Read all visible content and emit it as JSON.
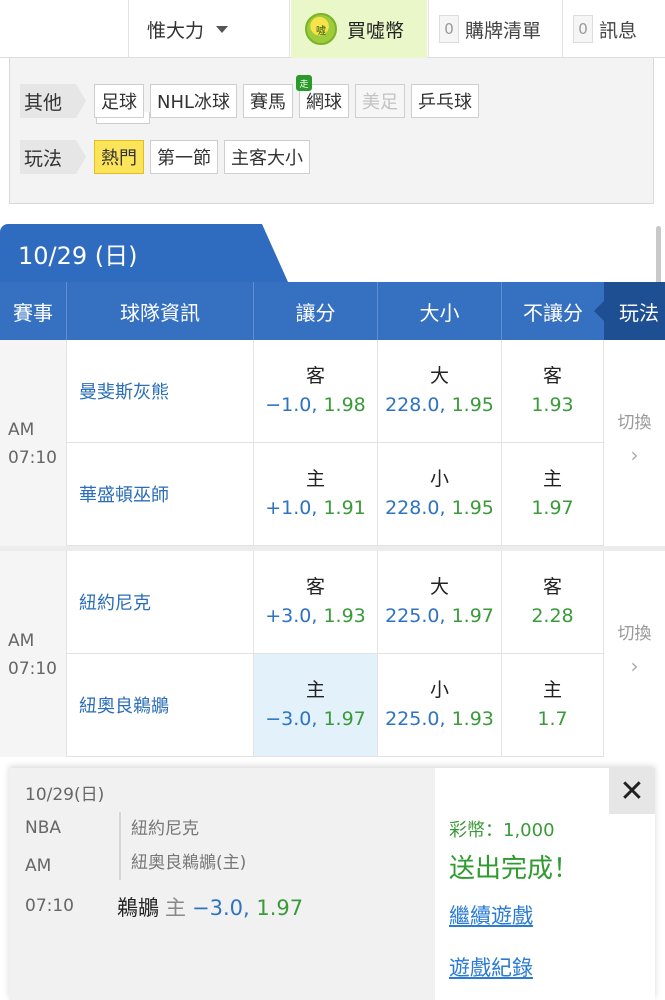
{
  "topbar": {
    "username": "惟大力",
    "coins_label": "買噓幣",
    "coin_icon_text": "噓",
    "cart_count": "0",
    "cart_label": "購牌清單",
    "msg_count": "0",
    "msg_label": "訊息"
  },
  "filter": {
    "other_label": "其他",
    "sports": [
      {
        "label": "足球",
        "state": "normal"
      },
      {
        "label": "NHL冰球",
        "state": "normal"
      },
      {
        "label": "賽馬",
        "state": "normal"
      },
      {
        "label": "網球",
        "state": "normal",
        "tag": "走"
      },
      {
        "label": "美足",
        "state": "disabled"
      },
      {
        "label": "乒乓球",
        "state": "normal"
      }
    ],
    "play_label": "玩法",
    "plays": [
      {
        "label": "熱門",
        "state": "active"
      },
      {
        "label": "第一節",
        "state": "normal"
      },
      {
        "label": "主客大小",
        "state": "normal"
      }
    ]
  },
  "date_tab": "10/29 (日)",
  "table": {
    "headers": [
      "賽事",
      "球隊資訊",
      "讓分",
      "大小",
      "不讓分"
    ],
    "play_tab": "玩法",
    "toggle_label": "切換",
    "games": [
      {
        "ampm": "AM",
        "time": "07:10",
        "rows": [
          {
            "team": "曼斐斯灰熊",
            "spread": {
              "label": "客",
              "handicap": "−1.0,",
              "price": "1.98"
            },
            "total": {
              "label": "大",
              "handicap": "228.0,",
              "price": "1.95"
            },
            "ml": {
              "label": "客",
              "price": "1.93"
            }
          },
          {
            "team": "華盛頓巫師",
            "spread": {
              "label": "主",
              "handicap": "+1.0,",
              "price": "1.91"
            },
            "total": {
              "label": "小",
              "handicap": "228.0,",
              "price": "1.95"
            },
            "ml": {
              "label": "主",
              "price": "1.97"
            }
          }
        ]
      },
      {
        "ampm": "AM",
        "time": "07:10",
        "rows": [
          {
            "team": "紐約尼克",
            "spread": {
              "label": "客",
              "handicap": "+3.0,",
              "price": "1.93"
            },
            "total": {
              "label": "大",
              "handicap": "225.0,",
              "price": "1.97"
            },
            "ml": {
              "label": "客",
              "price": "2.28"
            }
          },
          {
            "team": "紐奧良鵜鶘",
            "spread": {
              "label": "主",
              "handicap": "−3.0,",
              "price": "1.97"
            },
            "total": {
              "label": "小",
              "handicap": "225.0,",
              "price": "1.93"
            },
            "ml": {
              "label": "主",
              "price": "1.7"
            }
          }
        ]
      }
    ]
  },
  "popup": {
    "date": "10/29(日)",
    "league": "NBA",
    "ampm": "AM",
    "time": "07:10",
    "away": "紐約尼克",
    "home": "紐奧良鵜鶘(主)",
    "pick_team": "鵜鶘",
    "pick_side": "主",
    "pick_handicap": "−3.0,",
    "pick_price": "1.97",
    "fee": "彩幣：1,000",
    "status": "送出完成！",
    "continue_link": "繼續遊戲",
    "history_link": "遊戲紀錄",
    "close_glyph": "✕"
  }
}
